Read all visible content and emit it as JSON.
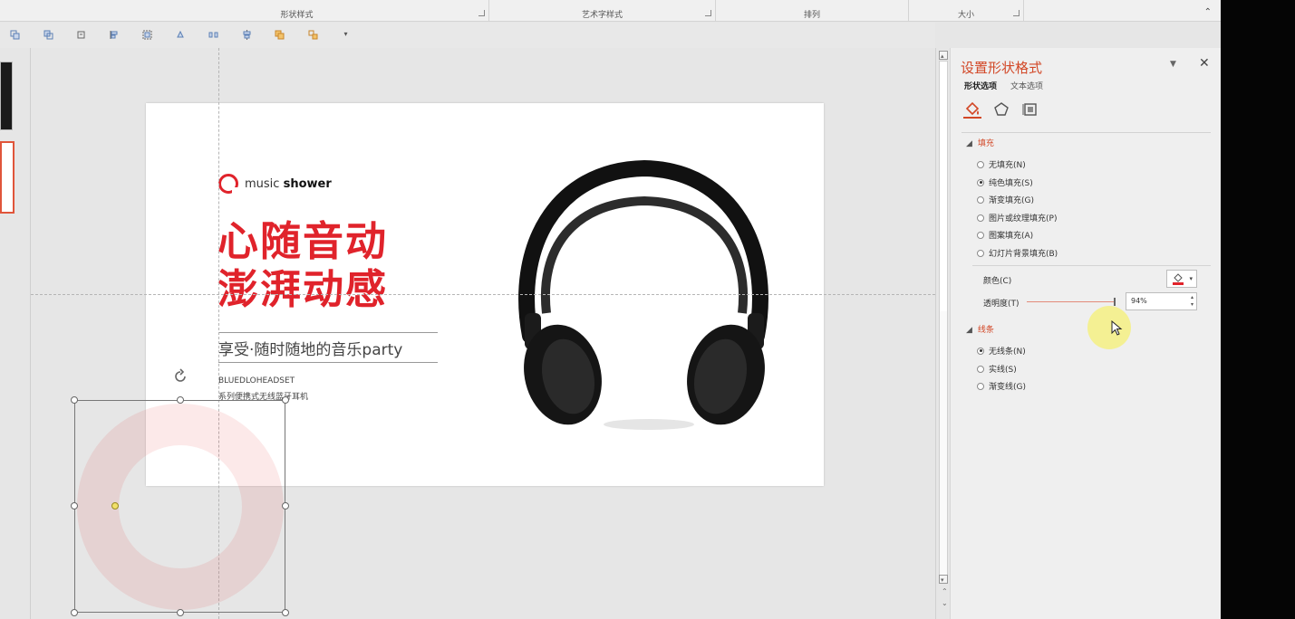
{
  "ribbon": {
    "groups": [
      {
        "label": "形状样式"
      },
      {
        "label": "艺术字样式"
      },
      {
        "label": "排列"
      },
      {
        "label": "大小"
      }
    ],
    "collapse_icon": "chevron-up-icon"
  },
  "quick_tools": [
    "bring-forward-icon",
    "send-backward-icon",
    "selection-pane-icon",
    "align-icon",
    "group-icon",
    "rotate-icon",
    "distribute-icon",
    "align-center-icon",
    "merge-shapes-icon",
    "edit-shape-icon",
    "more-icon"
  ],
  "slide": {
    "brand_prefix": "music ",
    "brand_bold": "shower",
    "headline1": "心随音动",
    "headline2": "澎湃动感",
    "tagline": "享受·随时随地的音乐party",
    "series_en": "BLUEDLOHEADSET",
    "series_cn": "系列便携式无线蓝牙耳机"
  },
  "pane": {
    "title": "设置形状格式",
    "tabs": {
      "shape": "形状选项",
      "text": "文本选项"
    },
    "icons": [
      "fill-line-icon",
      "effects-icon",
      "size-properties-icon"
    ],
    "fill_section": "填充",
    "fill_options": [
      {
        "label": "无填充(N)",
        "selected": false
      },
      {
        "label": "纯色填充(S)",
        "selected": true
      },
      {
        "label": "渐变填充(G)",
        "selected": false
      },
      {
        "label": "图片或纹理填充(P)",
        "selected": false
      },
      {
        "label": "图案填充(A)",
        "selected": false
      },
      {
        "label": "幻灯片背景填充(B)",
        "selected": false
      }
    ],
    "color_label": "颜色(C)",
    "transparency_label": "透明度(T)",
    "transparency_value": "94%",
    "transparency_level": 0.94,
    "line_section": "线条",
    "line_options": [
      {
        "label": "无线条(N)",
        "selected": true
      },
      {
        "label": "实线(S)",
        "selected": false
      },
      {
        "label": "渐变线(G)",
        "selected": false
      }
    ]
  },
  "colors": {
    "accent": "#d24726",
    "headline_red": "#e0232b",
    "ring_fill": "rgba(230,40,40,0.10)"
  }
}
